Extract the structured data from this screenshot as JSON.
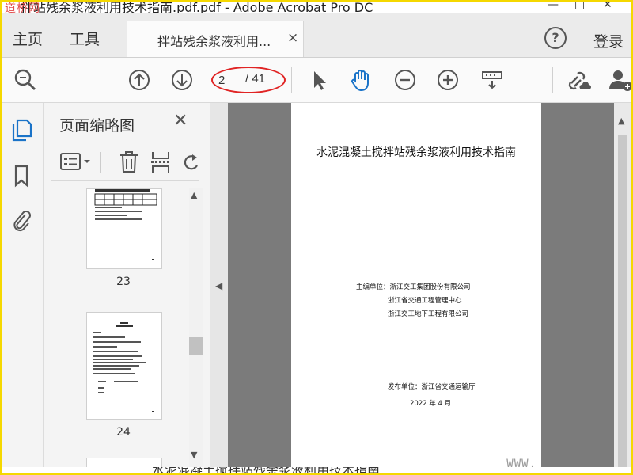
{
  "window": {
    "title": "拌站残余浆液利用技术指南.pdf.pdf - Adobe Acrobat Pro DC",
    "watermark_topleft": "道桥网",
    "controls": [
      "—",
      "□",
      "✕"
    ]
  },
  "menu": {
    "home": "主页",
    "tools": "工具",
    "doc_tab_label": "拌站残余浆液利用...",
    "doc_tab_close": "×",
    "help": "?",
    "login": "登录"
  },
  "toolbar": {
    "current_page": "2",
    "total_pages": "/ 41",
    "accent_color": "#1a73c8",
    "highlight_color": "#e02424",
    "icons": [
      "search-icon",
      "page-up-icon",
      "page-down-icon",
      "select-arrow-icon",
      "hand-tool-icon",
      "zoom-out-icon",
      "zoom-in-icon",
      "scroll-mode-icon",
      "share-link-icon",
      "add-user-icon"
    ]
  },
  "rail": {
    "icons": [
      "page-thumbnails-icon",
      "bookmarks-icon",
      "attachments-icon"
    ]
  },
  "thumbnails_panel": {
    "title": "页面缩略图",
    "close": "✕",
    "tools": [
      "thumbnail-options-icon",
      "delete-page-icon",
      "extract-pages-icon",
      "rotate-page-icon"
    ],
    "pages": [
      {
        "label": "23"
      },
      {
        "label": "24"
      }
    ]
  },
  "document": {
    "title": "水泥混凝土搅拌站残余浆液利用技术指南",
    "editor_label": "主编单位：浙江交工集团股份有限公司",
    "editor_2": "浙江省交通工程管理中心",
    "editor_3": "浙江交工地下工程有限公司",
    "publisher": "发布单位：浙江省交通运输厅",
    "date": "2022 年 4 月",
    "watermark": "WWW."
  },
  "bottom_strip_text": "水泥混凝土搅拌站残余浆液利用技术指南"
}
